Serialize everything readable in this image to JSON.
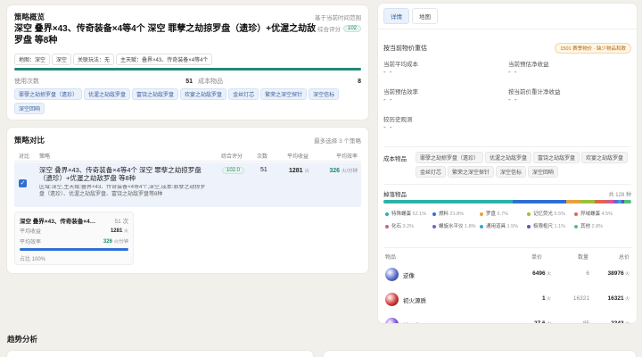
{
  "strategy_overview": {
    "section_title": "策略概览",
    "scope_note": "基于当前时间范围",
    "title": "深空 叠界×43、传奇装备×4等4个 深空 罪孽之劫掠罗盘（遗珍）+优渥之劫敌罗盘 等8种",
    "score_label": "综合评分",
    "score_value": "102",
    "meta_chips": [
      "地图：深空",
      "深空",
      "关联玩法：无",
      "主天赋：叠界×43、传奇装备×4等4个"
    ],
    "uses_label": "使用次数",
    "uses_value": "51",
    "cost_items_label": "成本物品",
    "cost_items_value": "8",
    "item_chips": [
      "罪孽之劫掠罗盘（遗珍）",
      "优渥之劫敌罗盘",
      "富饶之劫敌罗盘",
      "欢宴之劫敌罗盘",
      "金丝灯芯",
      "繁荣之深空探针",
      "深空信标",
      "深空回响"
    ]
  },
  "strategy_compare": {
    "section_title": "策略对比",
    "limit_note": "最多选择 3 个策略",
    "columns": [
      "对比",
      "策略",
      "综合评分",
      "次数",
      "平均收益",
      "平均效率"
    ],
    "rows": [
      {
        "title": "深空 叠界×43、传奇装备×4等4个 深空 罪孽之劫掠罗盘（遗珍）+优渥之劫敌罗盘 等8种",
        "detail": "区域:深空,主天赋:叠界×43、传奇装备×4等4个,深空,成本:罪孽之劫掠罗盘（遗珍）、优渥之劫敌罗盘、富饶之劫敌罗盘等8种",
        "score": "102.0",
        "count": "51",
        "avg_income": "1281",
        "avg_income_unit": "火",
        "avg_eff": "326",
        "avg_eff_unit": "火/分钟"
      }
    ],
    "summary": {
      "title": "深空 叠界×43、传奇装备×4…",
      "count": "51 次",
      "income_label": "平均收益",
      "income_value": "1281",
      "income_unit": "火",
      "eff_label": "平均效率",
      "eff_value": "326",
      "eff_unit": "火/分钟",
      "share_label": "占比 100%",
      "share_fraction": 1.0
    }
  },
  "details": {
    "tabs": [
      "详情",
      "地图"
    ],
    "active_tab": 0,
    "price_label": "按当前物价重估",
    "price_badge": "1501 赛季物价 · 缺少物品和数",
    "metrics": [
      {
        "label": "当前平均成本",
        "value": "- -"
      },
      {
        "label": "当前预估净收益",
        "value": "- -"
      },
      {
        "label": "当前预估效率",
        "value": "- -"
      },
      {
        "label": "按当前价重计净收益",
        "value": "- -"
      },
      {
        "label": "较历史观测",
        "value": "- -"
      }
    ],
    "cost_items_label": "成本物品",
    "cost_items": [
      "罪孽之劫掠罗盘（遗珍）",
      "优渥之劫敌罗盘",
      "富饶之劫敌罗盘",
      "欢宴之劫敌罗盘",
      "金丝灯芯",
      "繁荣之深空探针",
      "深空信标",
      "深空回响"
    ],
    "drops_label": "掉落物品",
    "drops_total": "共 128 种",
    "drop_legend": [
      {
        "name": "特殊螺蛋",
        "pct": "52.1%",
        "color": "#2bb3a8",
        "fraction": 0.521
      },
      {
        "name": "燃料",
        "pct": "21.8%",
        "color": "#2f6fd6",
        "fraction": 0.218
      },
      {
        "name": "罗盘",
        "pct": "5.7%",
        "color": "#e6a23c",
        "fraction": 0.057
      },
      {
        "name": "记忆荧光",
        "pct": "5.5%",
        "color": "#9bc23a",
        "fraction": 0.055
      },
      {
        "name": "异域螺蛋",
        "pct": "4.5%",
        "color": "#e0674f",
        "fraction": 0.045
      },
      {
        "name": "化石",
        "pct": "3.2%",
        "color": "#d65b8c",
        "fraction": 0.032
      },
      {
        "name": "螺旋水平仪",
        "pct": "1.8%",
        "color": "#7d5bd6",
        "fraction": 0.018
      },
      {
        "name": "通用道具",
        "pct": "1.5%",
        "color": "#3aa3d6",
        "fraction": 0.015
      },
      {
        "name": "极限枢尺",
        "pct": "1.1%",
        "color": "#6b4bc4",
        "fraction": 0.011
      },
      {
        "name": "其他",
        "pct": "2.8%",
        "color": "#55c27a",
        "fraction": 0.028
      }
    ],
    "drop_table_headers": [
      "物品",
      "单价",
      "数量",
      "总价"
    ],
    "drop_rows": [
      {
        "name": "逆像",
        "unit": "6496",
        "qty": "6",
        "total": "38976",
        "icon": "#5a6fd6"
      },
      {
        "name": "初火源质",
        "unit": "1",
        "qty": "16321",
        "total": "16321",
        "icon": "#d63a3a"
      },
      {
        "name": "神圣化石",
        "unit": "27.6",
        "qty": "85",
        "total": "2343",
        "icon": "#7a4bd6"
      }
    ],
    "currency_unit": "火"
  },
  "trend": {
    "section_title": "趋势分析"
  }
}
